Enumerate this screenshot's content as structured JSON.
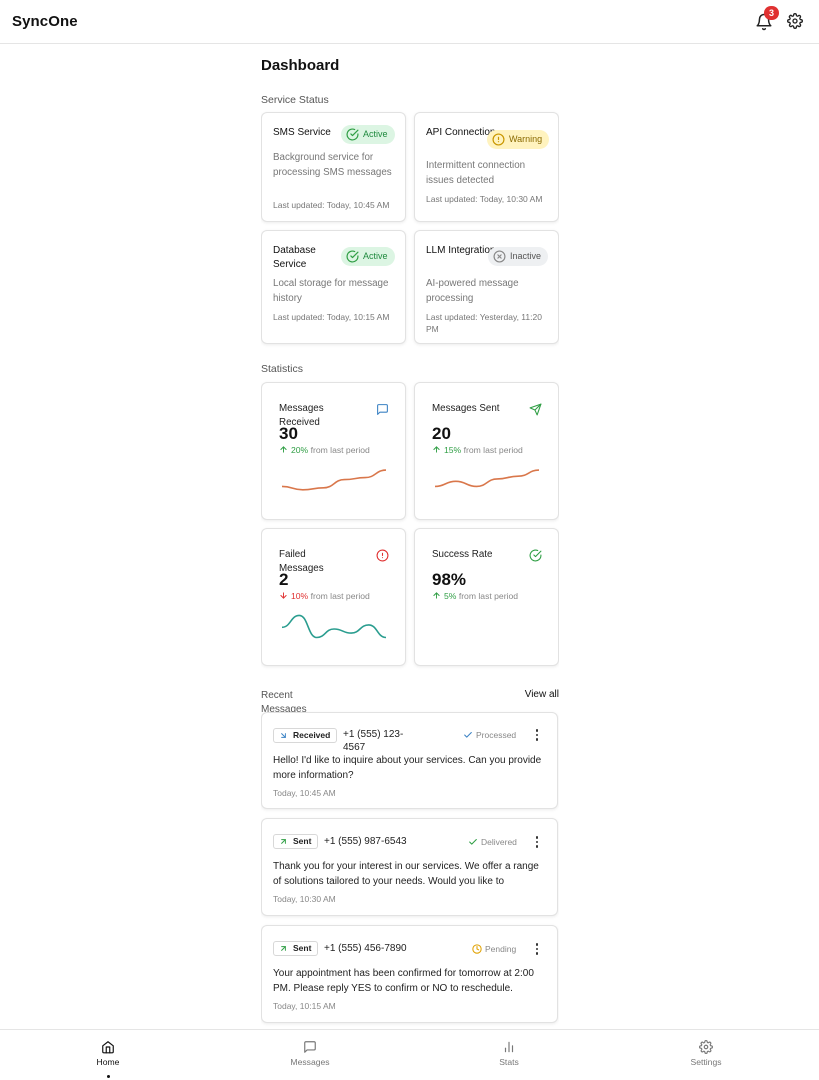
{
  "app": {
    "title": "SyncOne",
    "notification_count": "3"
  },
  "page": {
    "title": "Dashboard"
  },
  "service_status": {
    "label": "Service Status",
    "services": [
      {
        "name": "SMS Service",
        "status": "Active",
        "status_kind": "active",
        "description": "Background service for processing SMS messages",
        "updated": "Last updated: Today, 10:45 AM"
      },
      {
        "name": "API Connection",
        "status": "Warning",
        "status_kind": "warning",
        "description": "Intermittent connection issues detected",
        "updated": "Last updated: Today, 10:30 AM"
      },
      {
        "name": "Database Service",
        "status": "Active",
        "status_kind": "active",
        "description": "Local storage for message history",
        "updated": "Last updated: Today, 10:15 AM"
      },
      {
        "name": "LLM Integration",
        "status": "Inactive",
        "status_kind": "inactive",
        "description": "AI-powered message processing",
        "updated": "Last updated: Yesterday, 11:20 PM"
      }
    ]
  },
  "statistics": {
    "label": "Statistics",
    "cards": [
      {
        "label": "Messages Received",
        "value": "30",
        "change": "20%",
        "change_direction": "up",
        "change_suffix": "from last period",
        "icon": "message-square-icon",
        "sparkline": [
          40,
          30,
          36,
          60,
          66,
          88
        ]
      },
      {
        "label": "Messages Sent",
        "value": "20",
        "change": "15%",
        "change_direction": "up",
        "change_suffix": "from last period",
        "icon": "send-icon",
        "sparkline": [
          40,
          55,
          40,
          62,
          70,
          88
        ]
      },
      {
        "label": "Failed Messages",
        "value": "2",
        "change": "10%",
        "change_direction": "down",
        "change_suffix": "from last period",
        "icon": "alert-circle-icon",
        "sparkline": [
          55,
          90,
          25,
          50,
          38,
          62,
          25
        ]
      },
      {
        "label": "Success Rate",
        "value": "98%",
        "change": "5%",
        "change_direction": "up",
        "change_suffix": "from last period",
        "icon": "check-circle-icon"
      }
    ],
    "colors": {
      "positive_line": "#d9774b",
      "failed_line": "#2a9d8f",
      "up": "#2f9e44",
      "down": "#e03131"
    }
  },
  "recent_messages": {
    "label": "Recent Messages",
    "view_all": "View all",
    "items": [
      {
        "direction": "Received",
        "phone": "+1 (555) 123-4567",
        "status": "Processed",
        "status_kind": "processed",
        "body": "Hello! I'd like to inquire about your services. Can you provide more information?",
        "time": "Today, 10:45 AM"
      },
      {
        "direction": "Sent",
        "phone": "+1 (555) 987-6543",
        "status": "Delivered",
        "status_kind": "delivered",
        "body": "Thank you for your interest in our services. We offer a range of solutions tailored to your needs. Would you like to",
        "time": "Today, 10:30 AM"
      },
      {
        "direction": "Sent",
        "phone": "+1 (555) 456-7890",
        "status": "Pending",
        "status_kind": "pending",
        "body": "Your appointment has been confirmed for tomorrow at 2:00 PM. Please reply YES to confirm or NO to reschedule.",
        "time": "Today, 10:15 AM"
      }
    ]
  },
  "bottom_nav": {
    "items": [
      {
        "label": "Home",
        "icon": "home-icon",
        "active": true
      },
      {
        "label": "Messages",
        "icon": "message-square-icon",
        "active": false
      },
      {
        "label": "Stats",
        "icon": "bar-chart-icon",
        "active": false
      },
      {
        "label": "Settings",
        "icon": "gear-icon",
        "active": false
      }
    ]
  }
}
